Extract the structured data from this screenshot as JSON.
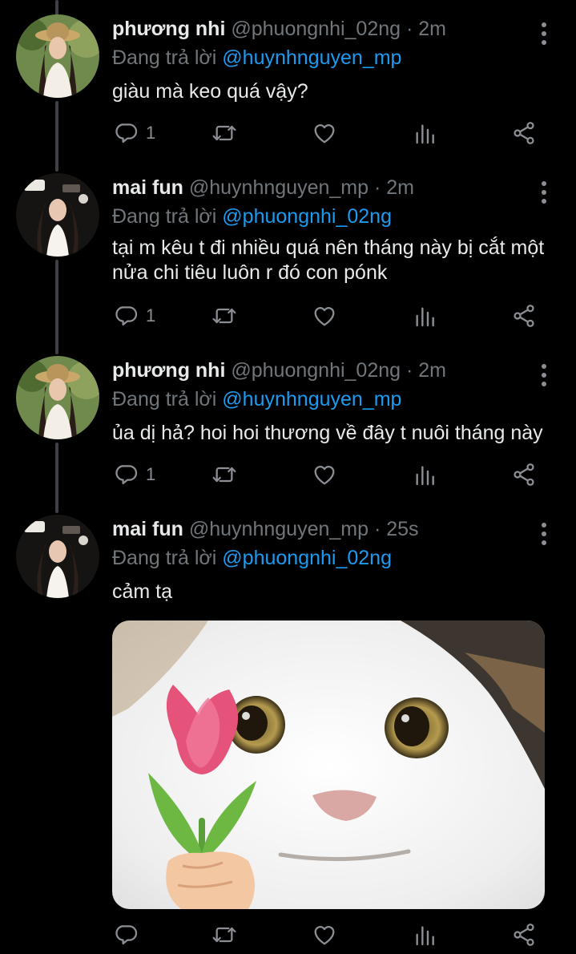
{
  "tweets": [
    {
      "name": "phương nhi",
      "handle": "@phuongnhi_02ng",
      "separator": "·",
      "time": "2m",
      "reply_prefix": "Đang trả lời",
      "reply_to": "@huynhnguyen_mp",
      "text": "giàu mà keo quá vậy?",
      "reply_count": "1"
    },
    {
      "name": "mai fun",
      "handle": "@huynhnguyen_mp",
      "separator": "·",
      "time": "2m",
      "reply_prefix": "Đang trả lời",
      "reply_to": "@phuongnhi_02ng",
      "text": "tại m kêu t đi nhiều quá nên tháng này bị cắt một nửa chi tiêu luôn r đó con pónk",
      "reply_count": "1"
    },
    {
      "name": "phương nhi",
      "handle": "@phuongnhi_02ng",
      "separator": "·",
      "time": "2m",
      "reply_prefix": "Đang trả lời",
      "reply_to": "@huynhnguyen_mp",
      "text": "ủa dị hả? hoi hoi thương về đây t nuôi tháng này",
      "reply_count": "1"
    },
    {
      "name": "mai fun",
      "handle": "@huynhnguyen_mp",
      "separator": "·",
      "time": "25s",
      "reply_prefix": "Đang trả lời",
      "reply_to": "@phuongnhi_02ng",
      "text": "cảm tạ",
      "reply_count": ""
    }
  ],
  "icons": {
    "reply": "reply-icon",
    "retweet": "retweet-icon",
    "like": "heart-icon",
    "views": "views-icon",
    "share": "share-icon",
    "more": "more-options-icon"
  },
  "colors": {
    "background": "#000000",
    "text": "#e7e9ea",
    "muted": "#71767b",
    "mention": "#1d9bf0",
    "thread_line": "#3d4145"
  }
}
